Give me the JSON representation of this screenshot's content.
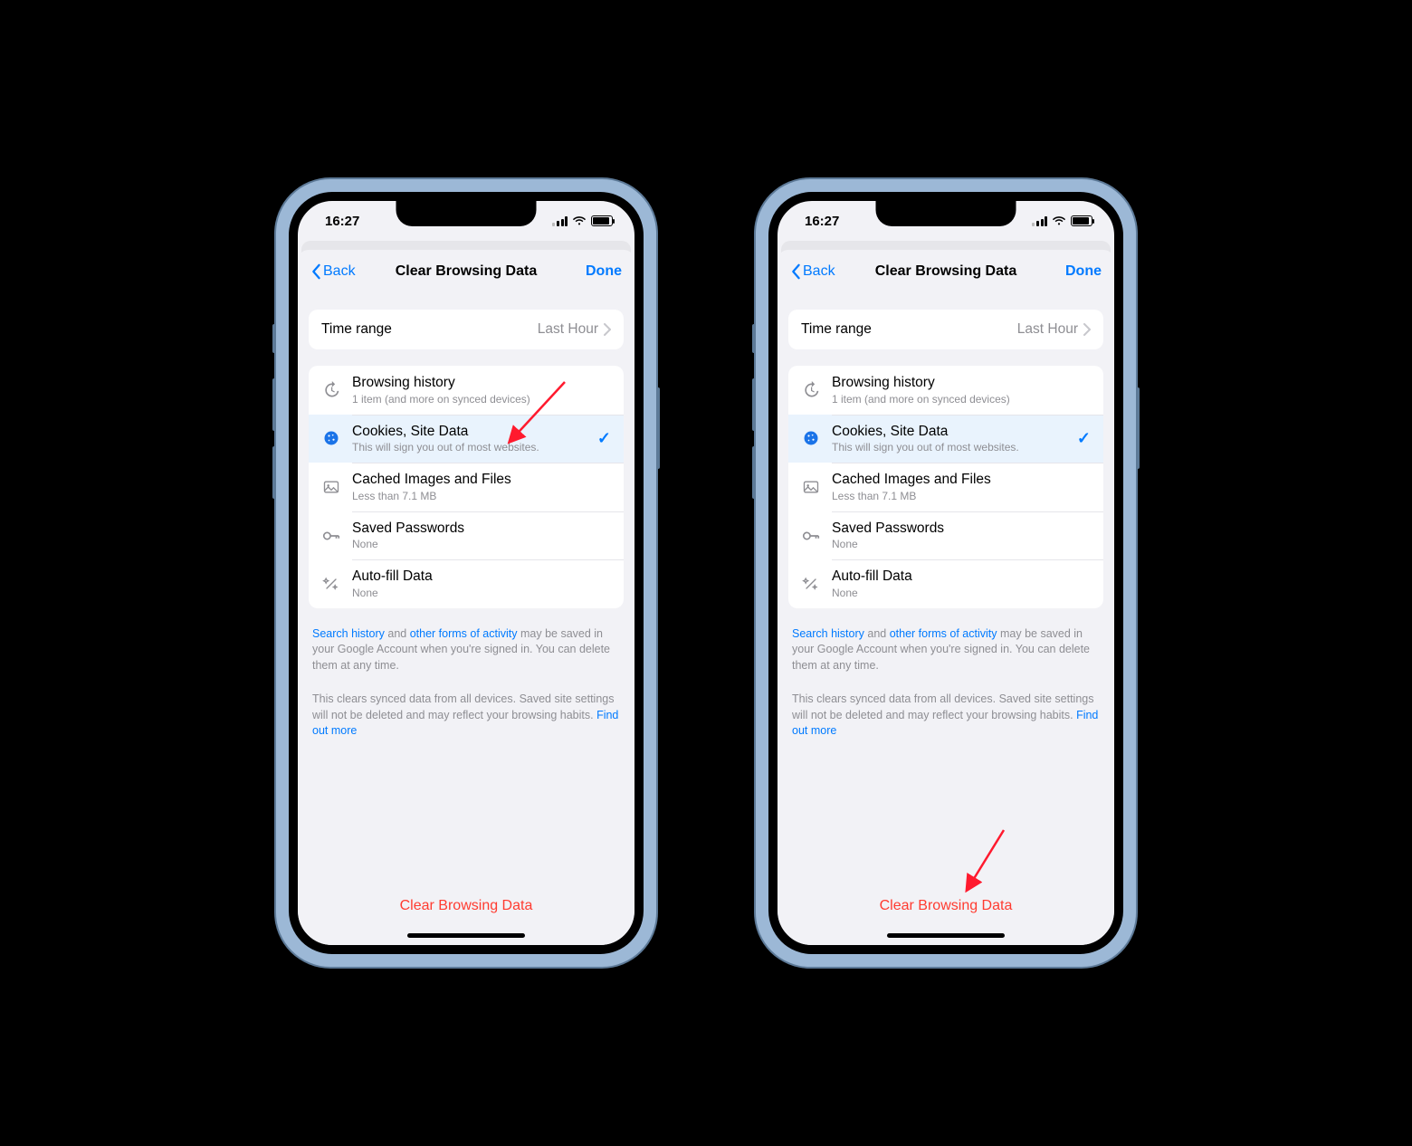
{
  "status": {
    "time": "16:27"
  },
  "nav": {
    "back_label": "Back",
    "title": "Clear Browsing Data",
    "done_label": "Done"
  },
  "time_range": {
    "label": "Time range",
    "value": "Last Hour"
  },
  "options": {
    "browsing_history": {
      "title": "Browsing history",
      "sub": "1 item (and more on synced devices)"
    },
    "cookies": {
      "title": "Cookies, Site Data",
      "sub": "This will sign you out of most websites."
    },
    "cached": {
      "title": "Cached Images and Files",
      "sub": "Less than 7.1 MB"
    },
    "passwords": {
      "title": "Saved Passwords",
      "sub": "None"
    },
    "autofill": {
      "title": "Auto-fill Data",
      "sub": "None"
    }
  },
  "footer": {
    "activity_link1": "Search history",
    "activity_mid1": " and ",
    "activity_link2": "other forms of activity",
    "activity_rest": " may be saved in your Google Account when you're signed in. You can delete them at any time.",
    "sync_text": "This clears synced data from all devices. Saved site settings will not be deleted and may reflect your browsing habits. ",
    "sync_link": "Find out more"
  },
  "clear_button": "Clear Browsing Data"
}
